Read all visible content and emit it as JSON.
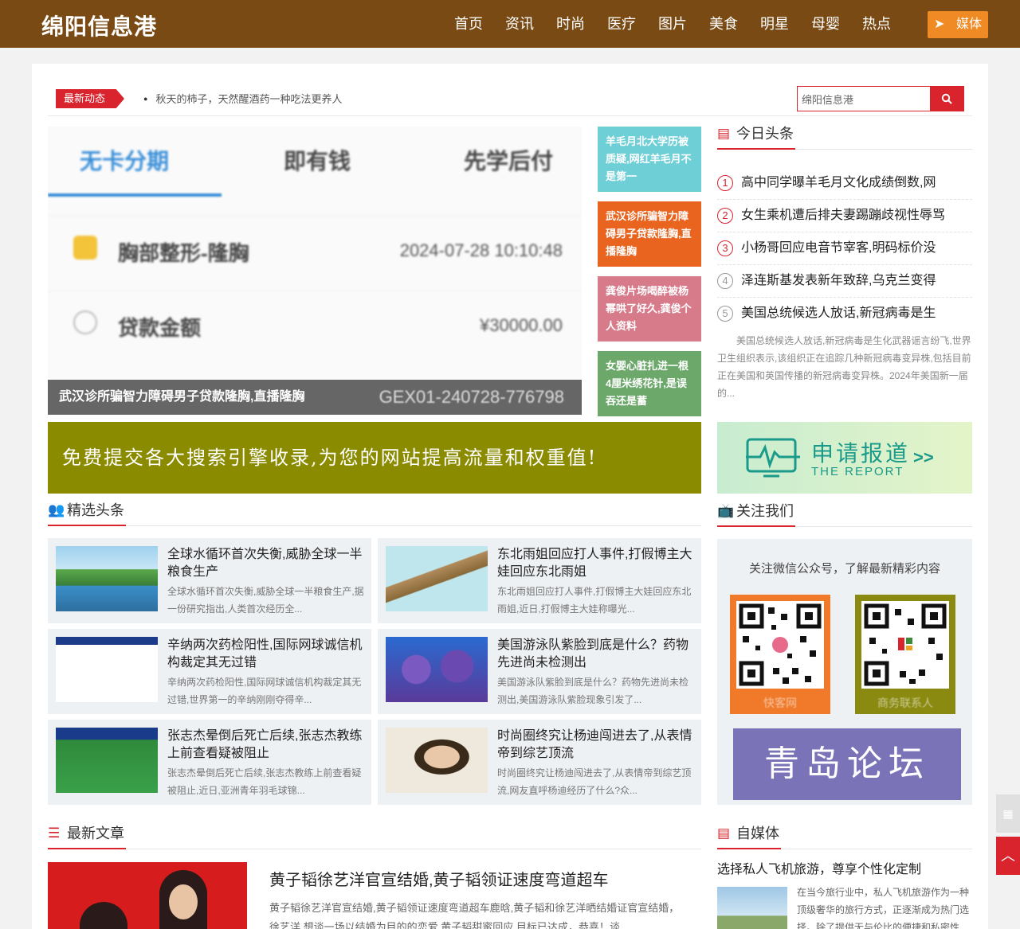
{
  "header": {
    "logo": "绵阳信息港",
    "nav": [
      "首页",
      "资讯",
      "时尚",
      "医疗",
      "图片",
      "美食",
      "明星",
      "母婴",
      "热点"
    ],
    "media_btn": "媒体"
  },
  "ticker": {
    "tag": "最新动态",
    "text": "秋天的柿子，天然醒酒药一种吃法更养人",
    "search_value": "绵阳信息港"
  },
  "slider": {
    "tabs": [
      "无卡分期",
      "即有钱",
      "先学后付"
    ],
    "rows": [
      {
        "name": "胸部整形-隆胸",
        "value": "2024-07-28 10:10:48"
      },
      {
        "name": "贷款金额",
        "value": "¥30000.00"
      }
    ],
    "caption": "武汉诊所骗智力障碍男子贷款隆胸,直播隆胸",
    "code": "GEX01-240728-776798"
  },
  "tiles": [
    {
      "text": "羊毛月北大学历被质疑,网红羊毛月不是第一",
      "color": "#6fcfd6"
    },
    {
      "text": "武汉诊所骗智力障碍男子贷款隆胸,直播隆胸",
      "color": "#e8641f"
    },
    {
      "text": "龚俊片场喝醉被杨幂哄了好久,龚俊个人资料",
      "color": "#d77a8a"
    },
    {
      "text": "女婴心脏扎进一根4厘米绣花针,是误吞还是蓄",
      "color": "#6ba86a"
    }
  ],
  "banner": "免费提交各大搜索引擎收录,为您的网站提高流量和权重值!",
  "sections": {
    "featured": "精选头条",
    "today": "今日头条",
    "follow": "关注我们",
    "latest": "最新文章",
    "zimeiti": "自媒体"
  },
  "hot": {
    "items": [
      {
        "num": "1",
        "title": "高中同学曝羊毛月文化成绩倒数,网"
      },
      {
        "num": "2",
        "title": "女生乘机遭后排夫妻踢蹦歧视性辱骂"
      },
      {
        "num": "3",
        "title": "小杨哥回应电音节宰客,明码标价没"
      },
      {
        "num": "4",
        "title": "泽连斯基发表新年致辞,乌克兰变得"
      },
      {
        "num": "5",
        "title": "美国总统候选人放话,新冠病毒是生"
      }
    ],
    "desc": "美国总统候选人放话,新冠病毒是生化武器谣言纷飞,世界卫生组织表示,该组织正在追踪几种新冠病毒变异株,包括目前正在美国和英国传播的新冠病毒变异株。2024年美国新一届的..."
  },
  "report": {
    "big": "申请报道",
    "small": "THE REPORT",
    "arrow": ">>"
  },
  "cards": [
    {
      "title": "全球水循环首次失衡,威胁全球一半粮食生产",
      "summary": "全球水循环首次失衡,威胁全球一半粮食生产,据一份研究指出,人类首次经历全..."
    },
    {
      "title": "东北雨姐回应打人事件,打假博主大娃回应东北雨姐",
      "summary": "东北雨姐回应打人事件,打假博主大娃回应东北雨姐,近日,打假博主大娃称曝光..."
    },
    {
      "title": "辛纳两次药检阳性,国际网球诚信机构裁定其无过错",
      "summary": "辛纳两次药检阳性,国际网球诚信机构裁定其无过错,世界第一的辛纳刚刚夺得辛..."
    },
    {
      "title": "美国游泳队紫脸到底是什么？药物先进尚未检测出",
      "summary": "美国游泳队紫脸到底是什么？药物先进尚未检测出,美国游泳队紫脸现象引发了..."
    },
    {
      "title": "张志杰晕倒后死亡后续,张志杰教练上前查看疑被阻止",
      "summary": "张志杰晕倒后死亡后续,张志杰教练上前查看疑被阻止,近日,亚洲青年羽毛球锦..."
    },
    {
      "title": "时尚圈终究让杨迪闯进去了,从表情帝到综艺顶流",
      "summary": "时尚圈终究让杨迪闯进去了,从表情帝到综艺顶流,网友直呼杨迪经历了什么?众..."
    }
  ],
  "follow": {
    "text": "关注微信公众号，了解最新精彩内容",
    "qr1_label": "快客网",
    "qr2_label": "商务联系人",
    "qr1_color": "#f07a2a",
    "qr2_color": "#8a8a10",
    "qingdao": "青岛论坛"
  },
  "article": {
    "title": "黄子韬徐艺洋官宣结婚,黄子韬领证速度弯道超车",
    "summary": "黄子韬徐艺洋官宣结婚,黄子韬领证速度弯道超车鹿晗,黄子韬和徐艺洋晒结婚证官宣结婚，徐艺洋 想谈一场以结婚为目的的恋爱 黄子韬甜蜜回应 目标已达成，恭喜！谈"
  },
  "zimeiti": {
    "title": "选择私人飞机旅游，尊享个性化定制",
    "text": "在当今旅行业中，私人飞机旅游作为一种顶级奢华的旅行方式，正逐渐成为热门选择。除了提供无与伦比的便捷和私密性"
  }
}
